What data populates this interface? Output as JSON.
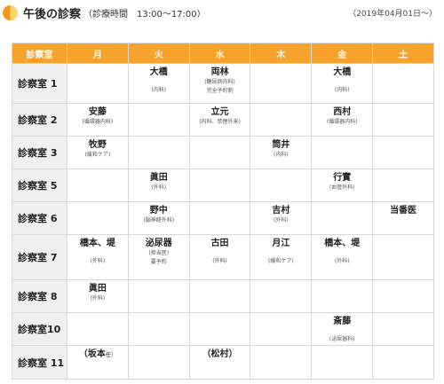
{
  "header": {
    "title": "午後の診察",
    "hours": "（診療時間　13:00〜17:00）",
    "date": "（2019年04月01日〜）"
  },
  "colors": {
    "accent": "#f6a22b",
    "room_bg": "#efefef"
  },
  "table": {
    "corner": "診察室",
    "days": [
      "月",
      "火",
      "水",
      "木",
      "金",
      "土"
    ],
    "rooms": [
      {
        "label": "診察室 1",
        "cells": [
          null,
          {
            "doctor": "大橋",
            "note": "(内科)",
            "lower": true
          },
          {
            "doctor": "両林",
            "note": "(糖尿病内科)",
            "extra": "完全予約制"
          },
          null,
          {
            "doctor": "大橋",
            "note": "(内科)",
            "lower": true
          },
          null
        ]
      },
      {
        "label": "診察室 2",
        "cells": [
          {
            "doctor": "安藤",
            "note": "(循環器内科)"
          },
          null,
          {
            "doctor": "立元",
            "note": "(内科、禁煙外来)"
          },
          null,
          {
            "doctor": "西村",
            "note": "(循環器内科)"
          },
          null
        ]
      },
      {
        "label": "診察室 3",
        "cells": [
          {
            "doctor": "牧野",
            "note": "(緩和ケア)"
          },
          null,
          null,
          {
            "doctor": "筒井",
            "note": "(内科)"
          },
          null,
          null
        ]
      },
      {
        "label": "診察室 5",
        "cells": [
          null,
          {
            "doctor": "眞田",
            "note": "(外科)"
          },
          null,
          null,
          {
            "doctor": "行實",
            "note": "(血管外科)"
          },
          null
        ]
      },
      {
        "label": "診察室 6",
        "cells": [
          null,
          {
            "doctor": "野中",
            "note": "(脳神経外科)"
          },
          null,
          {
            "doctor": "吉村",
            "note": "(外科)"
          },
          null,
          {
            "doctor": "当番医"
          }
        ]
      },
      {
        "label": "診察室 7",
        "cells": [
          {
            "doctor": "橋本、堤",
            "note": "(外科)",
            "lower": true
          },
          {
            "doctor": "泌尿器",
            "note": "(担当医)",
            "extra": "要予約"
          },
          {
            "doctor": "古田",
            "note": "(外科)",
            "lower": true
          },
          {
            "doctor": "月江",
            "note": "(緩和ケア)",
            "lower": true
          },
          {
            "doctor": "橋本、堤",
            "note": "(外科)",
            "lower": true
          },
          null
        ]
      },
      {
        "label": "診察室 8",
        "cells": [
          {
            "doctor": "眞田",
            "note": "(外科)"
          },
          null,
          null,
          null,
          null,
          null
        ]
      },
      {
        "label": "診察室10",
        "cells": [
          null,
          null,
          null,
          null,
          {
            "doctor": "斎藤",
            "note": "(泌尿器科)",
            "lower": true
          },
          null
        ]
      },
      {
        "label": "診察室 11",
        "cells": [
          {
            "doctor": "（坂本",
            "suffix": "任）"
          },
          null,
          {
            "doctor": "（松村）"
          },
          null,
          null,
          null
        ]
      }
    ]
  }
}
